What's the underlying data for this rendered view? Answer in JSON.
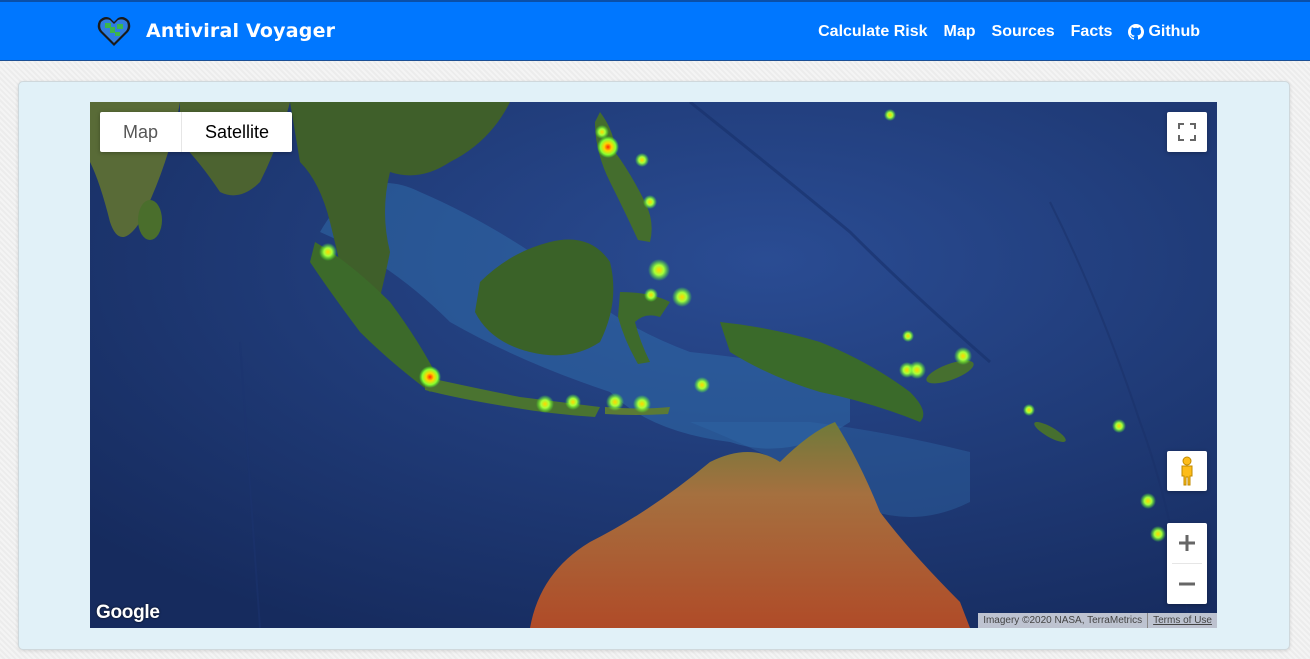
{
  "app": {
    "brand_name": "Antiviral Voyager",
    "logo_icon": "pixel-globe-heart-icon"
  },
  "nav": {
    "items": [
      {
        "label": "Calculate Risk"
      },
      {
        "label": "Map"
      },
      {
        "label": "Sources"
      },
      {
        "label": "Facts"
      },
      {
        "label": "Github",
        "icon": "github-icon"
      }
    ]
  },
  "map": {
    "type_control": {
      "map_label": "Map",
      "satellite_label": "Satellite",
      "selected": "Satellite"
    },
    "logo_text": "Google",
    "attribution": "Imagery ©2020 NASA, TerraMetrics",
    "terms": "Terms of Use",
    "controls": {
      "fullscreen_icon": "fullscreen-icon",
      "street_view_icon": "pegman-icon",
      "zoom_in_icon": "plus-icon",
      "zoom_out_icon": "minus-icon"
    },
    "colors": {
      "heat_low": "#7cff3a",
      "heat_mid": "#ffd400",
      "heat_high": "#ff2a00",
      "ocean": "#22407f"
    }
  }
}
